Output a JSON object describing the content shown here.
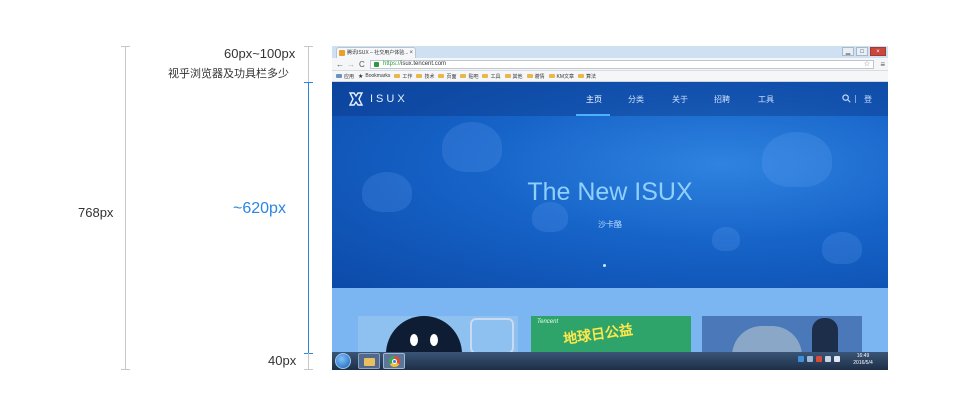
{
  "annotations": {
    "top_label": "60px~100px",
    "top_sub": "视乎浏览器及功具栏多少",
    "viewport_label": "~620px",
    "total_label": "768px",
    "bottom_label": "40px"
  },
  "browser": {
    "tab_title": "腾讯ISUX – 社交用户体验...",
    "tab_close": "×",
    "window_controls": [
      "▁",
      "□",
      "×"
    ],
    "nav_back": "←",
    "nav_forward": "→",
    "nav_reload": "C",
    "url_scheme": "https://",
    "url_rest": "isux.tencent.com",
    "star": "☆",
    "menu": "≡",
    "bookmarks": [
      "应用",
      "Bookmarks",
      "工作",
      "技术",
      "页面",
      "贴吧",
      "工具",
      "其他",
      "谢情",
      "KM文章",
      "算法"
    ]
  },
  "site": {
    "logo_text": "ISUX",
    "nav": [
      "主页",
      "分类",
      "关于",
      "招聘",
      "工具"
    ],
    "login": "登",
    "hero_title": "The New ISUX",
    "hero_subtitle": "沙卡酪",
    "card2_brand": "Tencent",
    "card2_text": "地球日公益"
  },
  "taskbar": {
    "time": "16:49",
    "date": "2016/5/4"
  },
  "colors": {
    "accent": "#2a86e3",
    "site_blue": "#1a63c8",
    "nav_underline": "#4fb0ff",
    "hero_title": "#8fd0ff"
  },
  "icons": {
    "search": "search-icon",
    "logo": "isux-logo-icon",
    "start": "windows-start-icon",
    "explorer": "folder-icon",
    "chrome": "chrome-icon"
  }
}
